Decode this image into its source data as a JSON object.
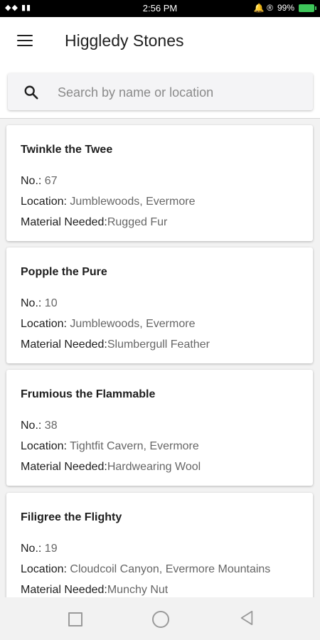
{
  "status_bar": {
    "signal": "◆◆ ▮▮",
    "time": "2:56 PM",
    "icons": "🔔 ®",
    "battery": "99%"
  },
  "app_bar": {
    "title": "Higgledy Stones",
    "menu_icon": "hamburger-menu-icon"
  },
  "search": {
    "placeholder": "Search by name or location",
    "value": ""
  },
  "cards": [
    {
      "name": "Twinkle the Twee",
      "no_label": "No.: ",
      "no": "67",
      "location_label": "Location: ",
      "location": "Jumblewoods, Evermore",
      "material_label": "Material Needed:",
      "material": "Rugged Fur"
    },
    {
      "name": "Popple the Pure",
      "no_label": "No.: ",
      "no": "10",
      "location_label": "Location: ",
      "location": "Jumblewoods, Evermore",
      "material_label": "Material Needed:",
      "material": "Slumbergull Feather"
    },
    {
      "name": "Frumious the Flammable",
      "no_label": "No.: ",
      "no": "38",
      "location_label": "Location: ",
      "location": "Tightfit Cavern, Evermore",
      "material_label": "Material Needed:",
      "material": "Hardwearing Wool"
    },
    {
      "name": "Filigree the Flighty",
      "no_label": "No.: ",
      "no": "19",
      "location_label": "Location: ",
      "location": "Cloudcoil Canyon, Evermore Mountains",
      "material_label": "Material Needed:",
      "material": "Munchy Nut"
    }
  ],
  "nav_bar": {
    "recents_icon": "square-recents-icon",
    "home_icon": "circle-home-icon",
    "back_icon": "triangle-back-icon"
  },
  "colors": {
    "status_bar_bg": "#000000",
    "app_bar_bg": "#ffffff",
    "list_bg": "#f2f2f2",
    "battery": "#3ec65a"
  }
}
